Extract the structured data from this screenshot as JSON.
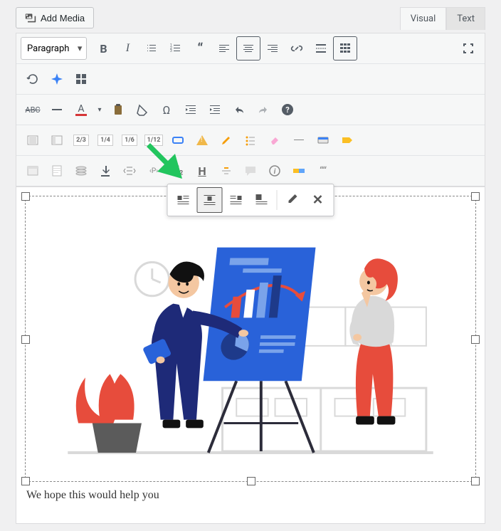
{
  "header": {
    "add_media_label": "Add Media",
    "tabs": {
      "visual": "Visual",
      "text": "Text",
      "active": "visual"
    }
  },
  "toolbar": {
    "format_selected": "Paragraph",
    "rows": [
      [
        {
          "id": "bold",
          "glyph": "B"
        },
        {
          "id": "italic",
          "glyph": "I"
        },
        {
          "id": "ul",
          "glyph": "list"
        },
        {
          "id": "ol",
          "glyph": "olist"
        },
        {
          "id": "quote",
          "glyph": "“"
        },
        {
          "id": "align-left",
          "glyph": "al"
        },
        {
          "id": "align-center",
          "glyph": "ac",
          "boxed": true
        },
        {
          "id": "align-right",
          "glyph": "ar"
        },
        {
          "id": "link",
          "glyph": "link"
        },
        {
          "id": "more",
          "glyph": "more"
        },
        {
          "id": "toolbar-toggle",
          "glyph": "tt",
          "boxed": true
        },
        {
          "id": "fullscreen",
          "glyph": "fs",
          "right": true
        }
      ],
      [
        {
          "id": "refresh",
          "glyph": "refresh"
        },
        {
          "id": "ai",
          "glyph": "ai"
        },
        {
          "id": "grid",
          "glyph": "grid"
        }
      ],
      [
        {
          "id": "strike",
          "glyph": "ABC"
        },
        {
          "id": "hr",
          "glyph": "—"
        },
        {
          "id": "textcolor",
          "glyph": "A"
        },
        {
          "id": "textcolor-dd",
          "glyph": "▾"
        },
        {
          "id": "paste",
          "glyph": "paste"
        },
        {
          "id": "clear",
          "glyph": "clear"
        },
        {
          "id": "omega",
          "glyph": "Ω"
        },
        {
          "id": "outdent",
          "glyph": "out"
        },
        {
          "id": "indent",
          "glyph": "in"
        },
        {
          "id": "undo",
          "glyph": "undo"
        },
        {
          "id": "redo",
          "glyph": "redo"
        },
        {
          "id": "help",
          "glyph": "?"
        }
      ],
      [
        {
          "id": "col-1",
          "glyph": "c1"
        },
        {
          "id": "col-2",
          "glyph": "c2"
        },
        {
          "id": "f23",
          "glyph": "2/3"
        },
        {
          "id": "f14",
          "glyph": "1/4"
        },
        {
          "id": "f16",
          "glyph": "1/6"
        },
        {
          "id": "f112",
          "glyph": "1/12"
        },
        {
          "id": "bluebox",
          "glyph": "bb"
        },
        {
          "id": "warn",
          "glyph": "warn"
        },
        {
          "id": "highlight",
          "glyph": "hl"
        },
        {
          "id": "checklist",
          "glyph": "cl"
        },
        {
          "id": "eraser",
          "glyph": "er"
        },
        {
          "id": "line",
          "glyph": "ln"
        },
        {
          "id": "card",
          "glyph": "cd"
        },
        {
          "id": "tag",
          "glyph": "tg"
        }
      ],
      [
        {
          "id": "window",
          "glyph": "win"
        },
        {
          "id": "note",
          "glyph": "nt"
        },
        {
          "id": "stack",
          "glyph": "st"
        },
        {
          "id": "download",
          "glyph": "dl"
        },
        {
          "id": "expand",
          "glyph": "ex"
        },
        {
          "id": "ptag",
          "glyph": "‹P›"
        },
        {
          "id": "h2",
          "glyph": "H₂"
        },
        {
          "id": "underline",
          "glyph": "H"
        },
        {
          "id": "align-tool",
          "glyph": "at"
        },
        {
          "id": "chat",
          "glyph": "ch"
        },
        {
          "id": "info",
          "glyph": "ⓘ"
        },
        {
          "id": "label",
          "glyph": "lb"
        },
        {
          "id": "copyright",
          "glyph": "cr"
        }
      ]
    ]
  },
  "float_toolbar": {
    "items": [
      {
        "id": "img-align-left",
        "active": false
      },
      {
        "id": "img-align-center",
        "active": true
      },
      {
        "id": "img-align-right",
        "active": false
      },
      {
        "id": "img-align-none",
        "active": false
      },
      {
        "id": "img-edit",
        "sep_before": true
      },
      {
        "id": "img-remove"
      }
    ]
  },
  "editor": {
    "caption": "We hope this would help you"
  }
}
